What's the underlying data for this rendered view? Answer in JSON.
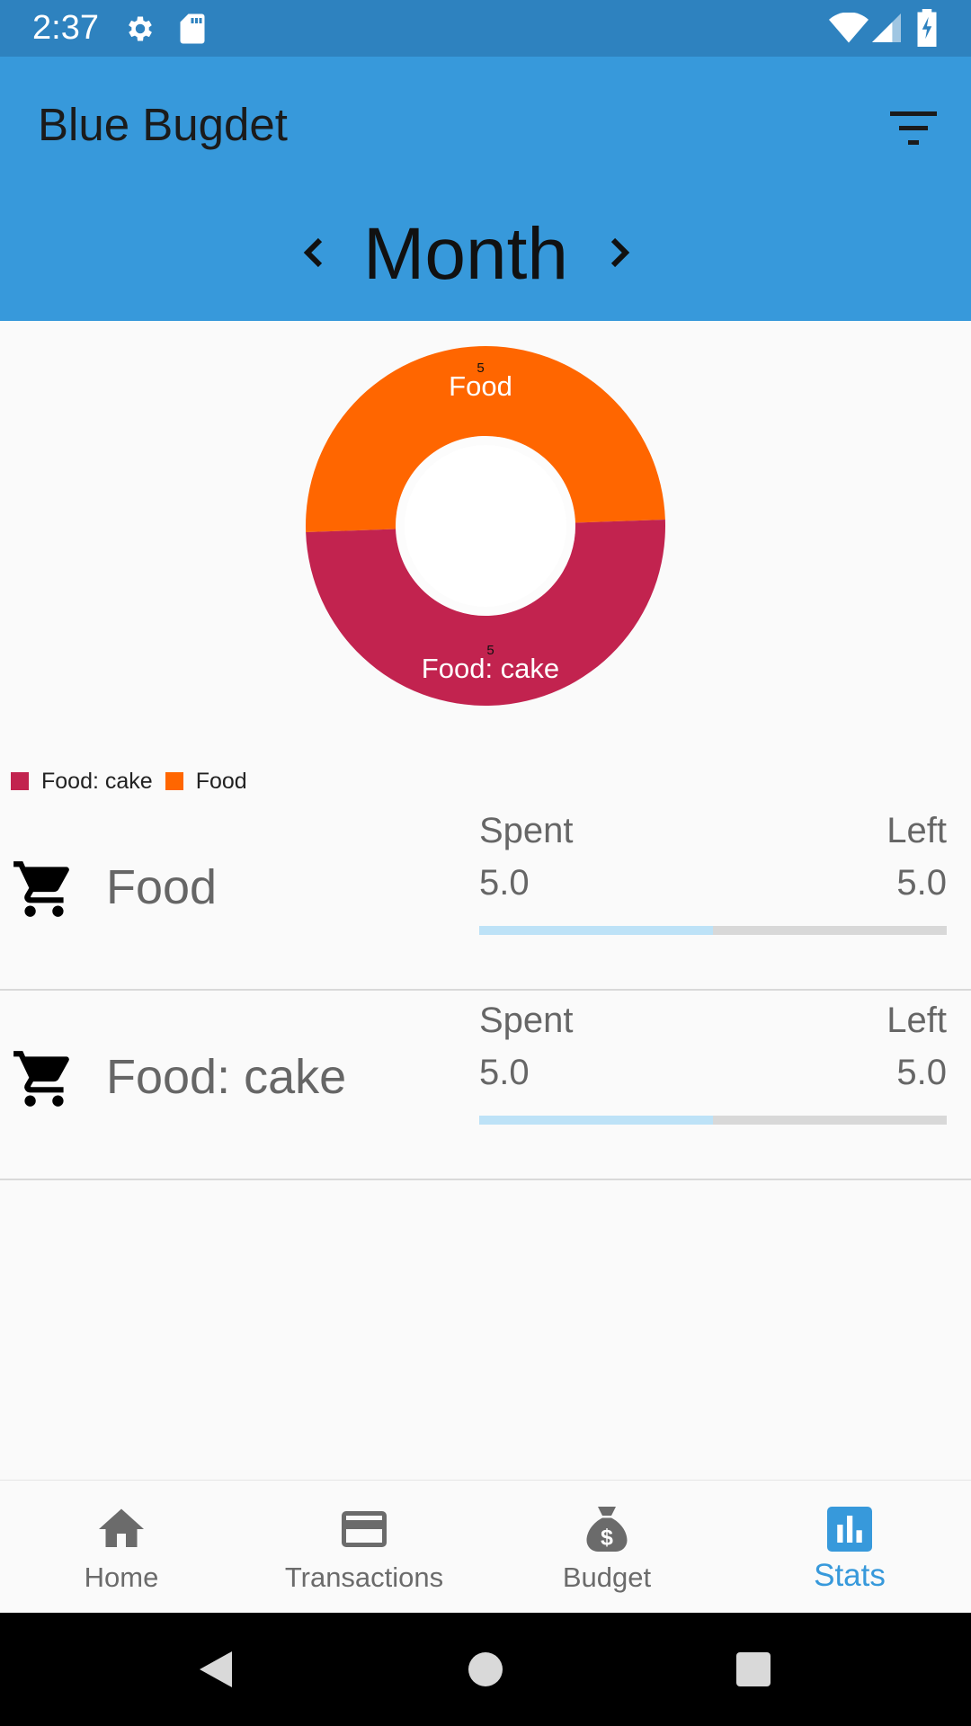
{
  "status_bar": {
    "time": "2:37",
    "icons": [
      "settings-icon",
      "sd-card-icon",
      "wifi-icon",
      "signal-icon",
      "battery-charging-icon"
    ]
  },
  "app_bar": {
    "title": "Blue Bugdet",
    "filter_icon": "filter-icon"
  },
  "period": {
    "label": "Month",
    "prev_icon": "chevron-left-icon",
    "next_icon": "chevron-right-icon"
  },
  "colors": {
    "primary": "#3799db",
    "status_bar": "#2e82bf",
    "food": "#ff6600",
    "food_cake": "#c2234f",
    "progress_fill": "#bde2f7",
    "progress_track": "#d8d8d8"
  },
  "chart_data": {
    "type": "pie",
    "donut": true,
    "categories": [
      "Food",
      "Food: cake"
    ],
    "values": [
      5,
      5
    ],
    "colors": [
      "#ff6600",
      "#c2234f"
    ],
    "data_labels": [
      "5",
      "5"
    ],
    "legend": {
      "position": "bottom-left",
      "entries": [
        "Food: cake",
        "Food"
      ]
    }
  },
  "legend": [
    {
      "label": "Food: cake",
      "color": "#c2234f"
    },
    {
      "label": "Food",
      "color": "#ff6600"
    }
  ],
  "budgets": [
    {
      "name": "Food",
      "icon": "cart-icon",
      "spent_label": "Spent",
      "left_label": "Left",
      "spent": "5.0",
      "left": "5.0",
      "progress": 0.5
    },
    {
      "name": "Food: cake",
      "icon": "cart-icon",
      "spent_label": "Spent",
      "left_label": "Left",
      "spent": "5.0",
      "left": "5.0",
      "progress": 0.5
    }
  ],
  "bottom_nav": [
    {
      "label": "Home",
      "icon": "home-icon",
      "active": false
    },
    {
      "label": "Transactions",
      "icon": "credit-card-icon",
      "active": false
    },
    {
      "label": "Budget",
      "icon": "money-bag-icon",
      "active": false
    },
    {
      "label": "Stats",
      "icon": "bar-chart-icon",
      "active": true
    }
  ],
  "system_nav": [
    "back-icon",
    "home-circle-icon",
    "recents-icon"
  ]
}
